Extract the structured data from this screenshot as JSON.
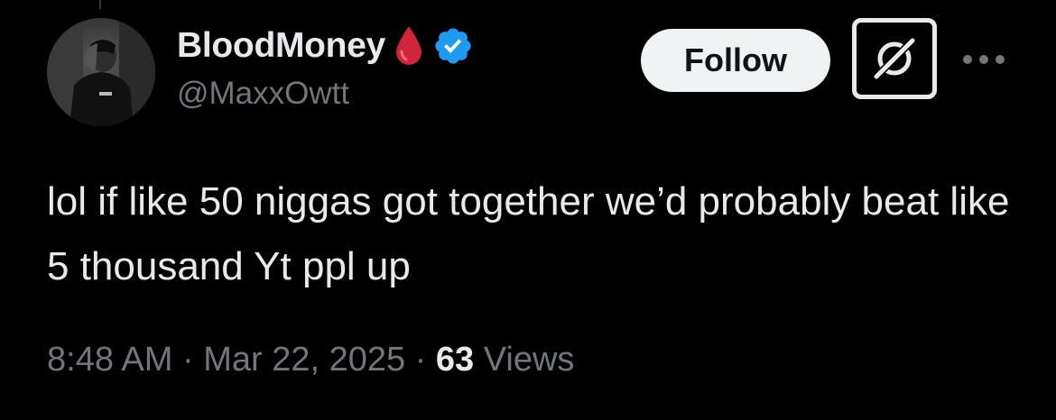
{
  "colors": {
    "background": "#000000",
    "primary_text": "#e7e9ea",
    "secondary_text": "#71767b",
    "verified_badge": "#1d9bf0",
    "drop_emoji": "#d0253a",
    "follow_bg": "#eff3f4"
  },
  "author": {
    "display_name": "BloodMoney",
    "handle": "@MaxxOwtt",
    "emoji_icon": "drop-of-blood-icon",
    "badge_icon": "verified-badge-icon",
    "avatar_icon": "avatar"
  },
  "header": {
    "follow_label": "Follow",
    "grok_icon": "grok-icon",
    "more_icon": "more-icon"
  },
  "tweet": {
    "text": "lol if like 50 niggas got together we’d probably beat like 5 thousand Yt ppl up"
  },
  "meta": {
    "time": "8:48 AM",
    "separator": " · ",
    "date": "Mar 22, 2025",
    "views_count": "63",
    "views_label": " Views"
  }
}
